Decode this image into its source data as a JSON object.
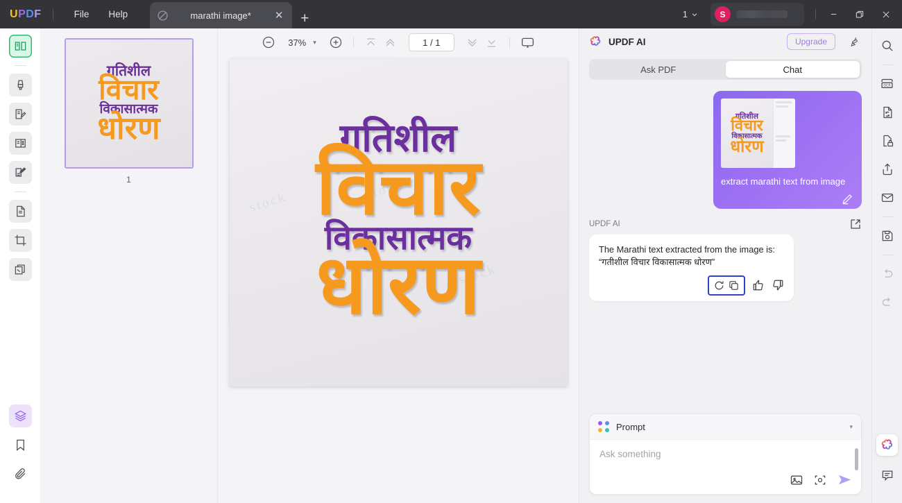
{
  "window": {
    "logo_letters": [
      "U",
      "P",
      "D",
      "F"
    ],
    "menu": [
      {
        "label": "File",
        "name": "menu-file"
      },
      {
        "label": "Help",
        "name": "menu-help"
      }
    ],
    "tab": {
      "title": "marathi image*",
      "close_label": "✕",
      "new_tab_label": "+"
    },
    "window_count": "1",
    "avatar_initial": "S",
    "controls": {
      "minimize": "—",
      "maximize": "❐",
      "close": "✕"
    }
  },
  "left_rail": {
    "items": [
      {
        "name": "sidebar-reader-icon",
        "icon": "reader-icon",
        "active": true
      },
      {
        "name": "sidebar-highlighter-icon",
        "icon": "marker-icon",
        "active": false
      },
      {
        "name": "sidebar-edit-pdf-icon",
        "icon": "edit-document-icon",
        "active": false
      },
      {
        "name": "sidebar-page-organize-icon",
        "icon": "book-pages-icon",
        "active": false
      },
      {
        "name": "sidebar-annotate-icon",
        "icon": "pen-note-icon",
        "active": false
      },
      {
        "name": "sidebar-convert-icon",
        "icon": "convert-file-icon",
        "active": false
      },
      {
        "name": "sidebar-crop-icon",
        "icon": "crop-icon",
        "active": false
      },
      {
        "name": "sidebar-batch-icon",
        "icon": "batch-pages-icon",
        "active": false
      }
    ],
    "bottom_items": [
      {
        "name": "sidebar-layers-icon",
        "icon": "layers-icon",
        "highlighted": true
      },
      {
        "name": "sidebar-bookmark-icon",
        "icon": "bookmark-icon",
        "highlighted": false
      },
      {
        "name": "sidebar-attachment-icon",
        "icon": "paperclip-icon",
        "highlighted": false
      }
    ]
  },
  "thumbnails": {
    "page_number": "1",
    "page_lines": [
      {
        "text": "गतिशील",
        "color": "purple",
        "size": 21
      },
      {
        "text": "विचार",
        "color": "orange",
        "size": 41
      },
      {
        "text": "विकासात्मक",
        "color": "purple",
        "size": 19
      },
      {
        "text": "धोरण",
        "color": "orange",
        "size": 45
      }
    ]
  },
  "toolbar": {
    "zoom_out": "zoom-out-icon",
    "zoom_value": "37%",
    "zoom_caret": "▾",
    "zoom_in": "zoom-in-icon",
    "first_page": "first-page-icon",
    "prev_page": "previous-page-icon",
    "page_indicator": "1 / 1",
    "next_page": "next-page-icon",
    "last_page": "last-page-icon",
    "presentation": "presentation-mode-icon"
  },
  "document": {
    "lines": [
      {
        "text": "गतिशील",
        "color": "purple",
        "size": 56
      },
      {
        "text": "विचार",
        "color": "orange",
        "size": 112
      },
      {
        "text": "विकासात्मक",
        "color": "purple",
        "size": 48
      },
      {
        "text": "धोरण",
        "color": "orange",
        "size": 118
      }
    ],
    "watermark": "stock"
  },
  "ai_panel": {
    "title": "UPDF AI",
    "upgrade_label": "Upgrade",
    "clear_icon": "broom-icon",
    "tabs": [
      {
        "label": "Ask PDF",
        "active": false
      },
      {
        "label": "Chat",
        "active": true
      }
    ],
    "user_message": {
      "text": "extract marathi text from image",
      "edit_icon": "pencil-icon",
      "attachment_lines": [
        {
          "text": "गतिशील",
          "color": "purple",
          "size": 11
        },
        {
          "text": "विचार",
          "color": "orange",
          "size": 22
        },
        {
          "text": "विकासात्मक",
          "color": "purple",
          "size": 10
        },
        {
          "text": "धोरण",
          "color": "orange",
          "size": 24
        }
      ]
    },
    "ai_message": {
      "sender_label": "UPDF AI",
      "expand_icon": "open-external-icon",
      "line1": "The Marathi text extracted from the image is:",
      "line2": "“गतीशील विचार विकासात्मक धोरण”",
      "actions": [
        {
          "name": "regenerate-icon",
          "highlighted": true
        },
        {
          "name": "copy-icon",
          "highlighted": true
        },
        {
          "name": "thumbs-up-icon",
          "highlighted": false
        },
        {
          "name": "thumbs-down-icon",
          "highlighted": false
        }
      ]
    },
    "prompt": {
      "header_label": "Prompt",
      "header_caret": "▾",
      "placeholder": "Ask something",
      "value": "",
      "image_icon": "insert-image-icon",
      "screenshot_icon": "screenshot-area-icon",
      "send_icon": "send-icon"
    }
  },
  "right_rail": {
    "items": [
      {
        "name": "search-icon"
      },
      {
        "name": "ocr-icon"
      },
      {
        "name": "convert-icon"
      },
      {
        "name": "protect-icon"
      },
      {
        "name": "share-icon"
      },
      {
        "name": "email-icon"
      },
      {
        "name": "save-icon"
      },
      {
        "name": "undo-icon"
      },
      {
        "name": "redo-icon"
      }
    ],
    "bottom_items": [
      {
        "name": "updf-ai-icon"
      },
      {
        "name": "comment-icon"
      }
    ]
  },
  "colors": {
    "accent_purple": "#8a5cf0",
    "doc_purple": "#6b2f9e",
    "doc_orange": "#f59a1e",
    "active_green": "#2fbd72",
    "avatar_pink": "#e01f5e",
    "highlight_blue": "#2c45c8"
  }
}
